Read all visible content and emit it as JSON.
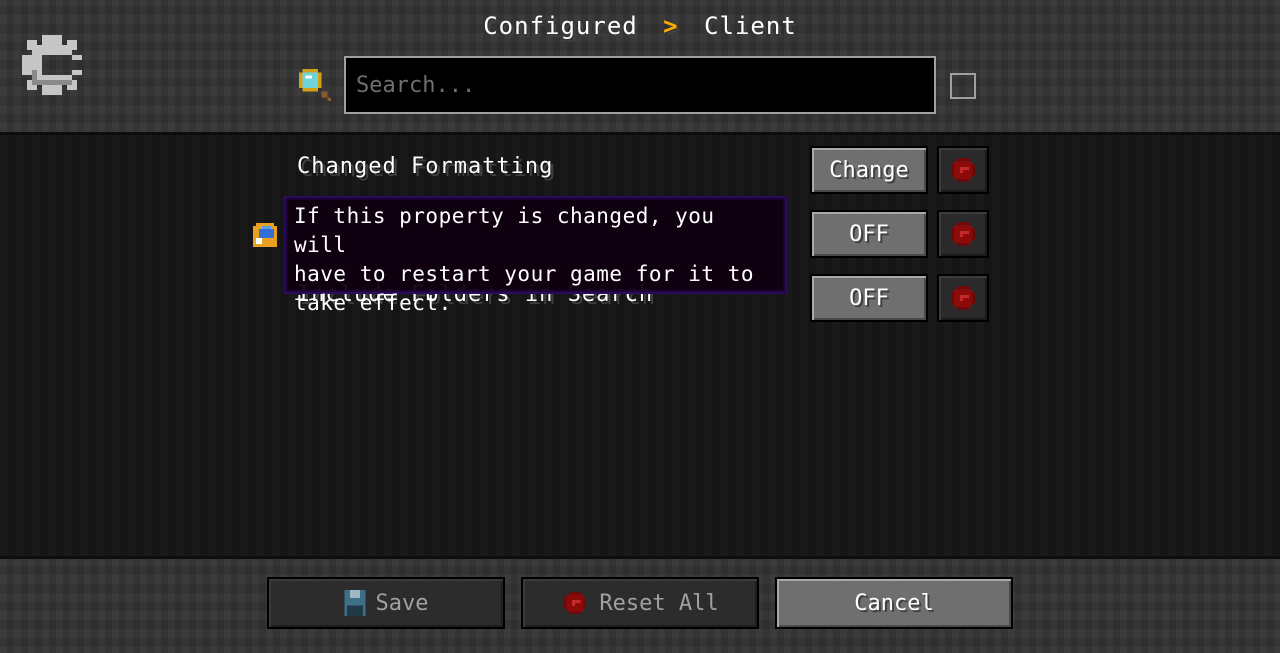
{
  "header": {
    "breadcrumb": {
      "root": "Configured",
      "separator": ">",
      "current": "Client"
    },
    "logo_icon": "gear-icon",
    "search": {
      "icon": "magnifier-icon",
      "value": "",
      "placeholder": "Search..."
    },
    "filter_checkbox": {
      "checked": false
    }
  },
  "rows": [
    {
      "label": "Changed Formatting",
      "button_label": "Change",
      "reset_icon": "reset-icon"
    },
    {
      "label": "",
      "button_label": "OFF",
      "reset_icon": "reset-icon",
      "requires_restart": true
    },
    {
      "label": "Include Folders in Search",
      "button_label": "OFF",
      "reset_icon": "reset-icon"
    }
  ],
  "tooltip": {
    "text_line1": "If this property is changed, you will",
    "text_line2": "have to restart your game for it to",
    "text_line3": "take effect."
  },
  "footer": {
    "save_label": "Save",
    "reset_all_label": "Reset All",
    "cancel_label": "Cancel"
  },
  "colors": {
    "accent": "#ffaa00",
    "tooltip_border": "#2b0a5e",
    "reset_red": "#8b0a0a"
  }
}
